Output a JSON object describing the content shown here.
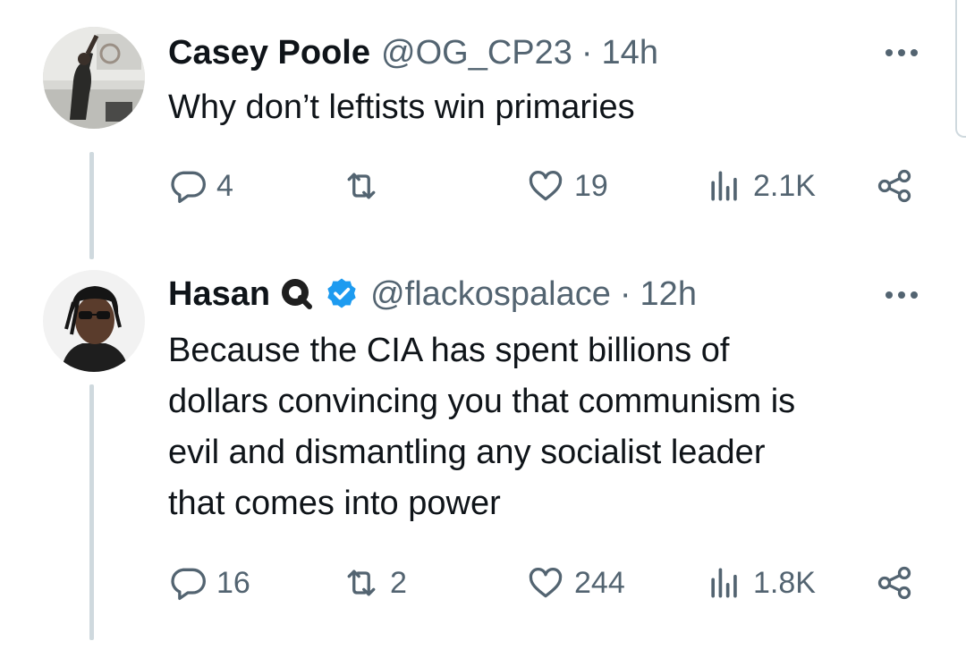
{
  "tweets": [
    {
      "display_name": "Casey Poole",
      "handle": "@OG_CP23",
      "separator": "·",
      "time": "14h",
      "text": [
        "Why don’t leftists win primaries"
      ],
      "replies": "4",
      "retweets": "",
      "likes": "19",
      "views": "2.1K"
    },
    {
      "display_name": "Hasan",
      "handle": "@flackospalace",
      "separator": "·",
      "time": "12h",
      "text": [
        "Because the CIA has spent billions of",
        "dollars convincing you that communism is",
        "evil and dismantling any socialist leader",
        "that comes into power"
      ],
      "replies": "16",
      "retweets": "2",
      "likes": "244",
      "views": "1.8K"
    }
  ],
  "colors": {
    "text": "#0f1419",
    "muted": "#536471",
    "thread_line": "#cfd9de",
    "verified": "#1d9bf0"
  }
}
